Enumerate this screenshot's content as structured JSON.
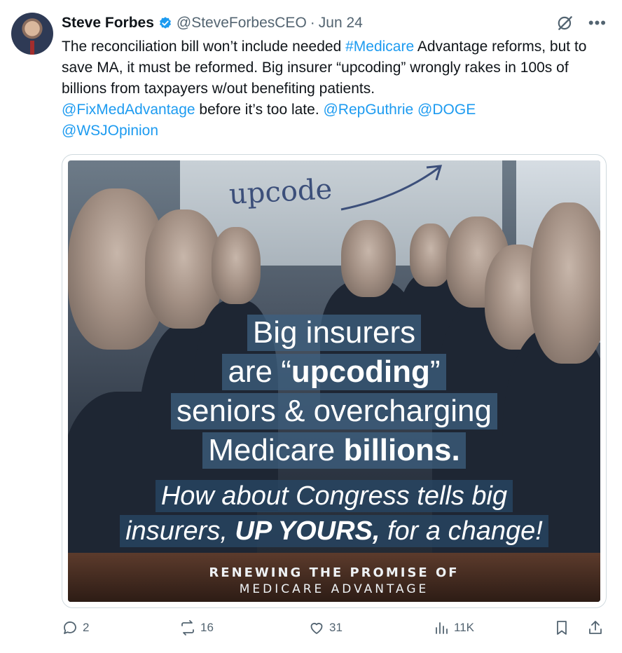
{
  "author": {
    "name": "Steve Forbes",
    "handle": "@SteveForbesCEO",
    "separator": "·",
    "date": "Jun 24",
    "verified_color": "#1d9bf0"
  },
  "tweet": {
    "text_before": "The reconciliation bill won’t include needed ",
    "hashtag": "#Medicare",
    "text_middle": " Advantage reforms, but to save MA, it must be reformed. Big insurer “upcoding” wrongly rakes in 100s of billions from taxpayers w/out benefiting patients. ",
    "mention1": "@FixMedAdvantage",
    "text_after": " before it’s too late. ",
    "mention2": "@RepGuthrie",
    "mention3": "@DOGE",
    "mention4": "@WSJOpinion",
    "link_color": "#1d9bf0"
  },
  "image": {
    "board_word": "upcode",
    "caption1_l1": "Big insurers",
    "caption1_l2_a": "are “",
    "caption1_l2_b": "upcoding",
    "caption1_l2_c": "”",
    "caption1_l3": "seniors & overcharging",
    "caption1_l4_a": "Medicare ",
    "caption1_l4_b": "billions.",
    "caption2_l1": "How about Congress tells big",
    "caption2_l2_a": "insurers, ",
    "caption2_l2_b": "UP YOURS,",
    "caption2_l2_c": " for a change!",
    "brand_l1": "RENEWING THE PROMISE OF",
    "brand_l2": "MEDICARE ADVANTAGE"
  },
  "actions": {
    "replies": "2",
    "reposts": "16",
    "likes": "31",
    "views": "11K"
  },
  "icons": [
    "verified-icon",
    "grok-icon",
    "more-icon",
    "reply-icon",
    "repost-icon",
    "like-icon",
    "views-icon",
    "bookmark-icon",
    "share-icon"
  ]
}
